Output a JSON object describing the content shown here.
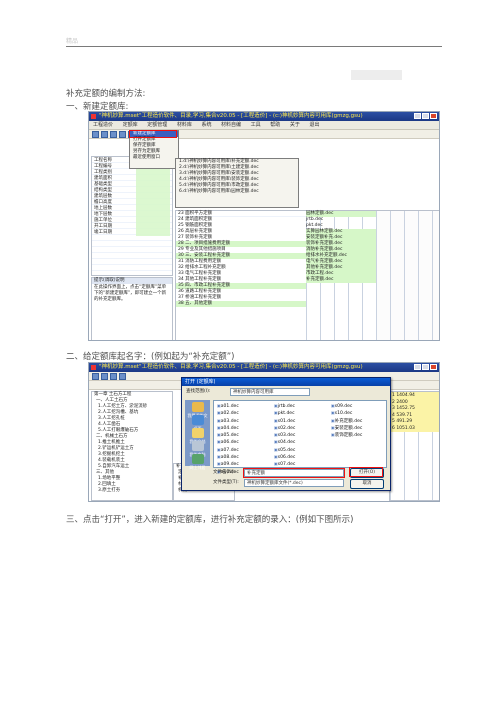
{
  "header": {
    "mark": "精品"
  },
  "intro": "补充定额的编制方法:",
  "step1": "一、新建定额库:",
  "step2": "二、给定额库起名字：(例如起为“补充定额”)",
  "step3": "三、点击“打开”，进入新建的定额库，进行补充定额的录入：(例如下图所示)",
  "shot1": {
    "title": "\"神机妙算.mset\"工程造价软件、目录,学习,集合v20.05 - [工程造价] - (c:)神机妙算内容可用库(gmzg,gsu)",
    "menus": [
      "工程造价",
      "定额库",
      "定额管理",
      "材料库",
      "系统",
      "材料自编",
      "工具",
      "帮助",
      "关于",
      "退出"
    ],
    "file_menu": [
      "新建定额库",
      "打开定额库",
      "保存定额库",
      "另存为定额库",
      "最近使用窗口"
    ],
    "recent": [
      "1.d:\\神机妙算内容可用库\\补充定额.dec",
      "2.d:\\神机妙算内容可用库\\土建定额.dec",
      "3.d:\\神机妙算内容可用库\\安装定额.dec",
      "4.d:\\神机妙算内容可用库\\装饰定额.dec",
      "5.d:\\神机妙算内容可用库\\市政定额.dec",
      "6.d:\\神机妙算内容可用库\\园林定额.dec"
    ],
    "left_rows": [
      "工程名称",
      "工程编号",
      "工程类别",
      "建筑面积",
      "基础类型",
      "结构类型",
      "建筑层数",
      "檐口高度",
      "地上层数",
      "地下层数",
      "施工单位",
      "开工日期",
      "竣工日期"
    ],
    "table_rows": [
      [
        "23",
        "0",
        "1",
        "面积平方定额"
      ],
      [
        "24",
        "0",
        "1",
        "建筑面积定额"
      ],
      [
        "25",
        "0",
        "1",
        "钢筋面积定额"
      ],
      [
        "26",
        "0",
        "1",
        "高层补充定额"
      ],
      [
        "27",
        "0",
        "1",
        "装饰补充定额"
      ],
      [
        "28",
        "0",
        "1",
        "二、项目措施费用定额"
      ],
      [
        "29",
        "0",
        "1",
        "专业及其他措施项目"
      ],
      [
        "30",
        "0",
        "1",
        "三、安装工程补充定额"
      ],
      [
        "31",
        "0",
        "1",
        "消防工程费用定额"
      ],
      [
        "32",
        "0",
        "1",
        "给排水工程补充定额"
      ],
      [
        "33",
        "0",
        "1",
        "电气工程补充定额"
      ],
      [
        "34",
        "0",
        "1",
        "其他工程补充定额"
      ],
      [
        "35",
        "0",
        "1",
        "四、市政工程补充定额"
      ],
      [
        "36",
        "0",
        "1",
        "道路工程补充定额"
      ],
      [
        "37",
        "0",
        "1",
        "桥涵工程补充定额"
      ],
      [
        "38",
        "0",
        "1",
        "五、其他定额"
      ]
    ],
    "right_rows": [
      "园林定额.dec",
      "",
      "jrtb.dec",
      "",
      "pkt.dec",
      "",
      "实算园林定额.dec",
      "安装定额补充.dec",
      "装饰补充定额.dec",
      "消防补充定额.dec",
      "给排水补充定额.dec",
      "电气补充定额.dec",
      "其他补充定额.dec",
      "",
      "市政工程.dec",
      "",
      "补充定额.dec"
    ],
    "note": "提示(调取)说明",
    "note_text": "在此操作界面上，点击“定额库”菜单下的“新建定额库”，即可建立一个新的补充定额库。"
  },
  "shot2": {
    "title": "\"神机妙算.mset\"工程造价软件、目录,学习,集合v20.05 - [工程造价] - (c:)神机妙算内容可用库(gmzg,gsu)",
    "dialog_title": "打开 (定额库)",
    "look_in_label": "查找范围(I):",
    "look_in_value": "神机妙算内容可用库",
    "places": [
      "我最近的文档",
      "桌面",
      "我的文档",
      "我的电脑",
      "网上邻居"
    ],
    "files_col1": [
      "a01.dec",
      "a02.dec",
      "a03.dec",
      "a04.dec",
      "a05.dec",
      "a06.dec",
      "a07.dec",
      "a08.dec",
      "a09.dec",
      "a10.dec",
      "a11.dec",
      "a12.dec",
      "a13.dec",
      "a14.dec",
      "a15.dec"
    ],
    "files_col2": [
      "jrtb.dec",
      "pkt.dec",
      "s01.dec",
      "s02.dec",
      "s03.dec",
      "s04.dec",
      "s05.dec",
      "s06.dec",
      "s07.dec",
      "s08.dec",
      "s09.dec",
      "s10.dec",
      "补充定额.dec",
      "安装定额.dec",
      "装饰定额.dec"
    ],
    "filename_label": "文件名(N):",
    "filename_value": "补充定额",
    "filetype_label": "文件类型(T):",
    "filetype_value": "神机妙算定额库文件(*.dec)",
    "open_button": "打开(O)",
    "cancel_button": "取消",
    "tree": [
      "第一章 土石方工程",
      "一、人工土石方",
      "1.人工挖土方、淤泥流砂",
      "2.人工挖沟槽、基坑",
      "3.人工挖孔桩",
      "4.人工凿石",
      "5.人工打眼爆破石方",
      "二、机械土石方",
      "1.推土机推土",
      "2.铲运机铲运土方",
      "3.挖掘机挖土",
      "4.装载机装土",
      "5.自卸汽车运土",
      "三、其他",
      "1.场地平整",
      "2.回填土",
      "3.原土打夯"
    ],
    "tree2": [
      "补充定额库(A)",
      "定额子目",
      "补充子目",
      "材料",
      "机械",
      "配合比"
    ],
    "numbers": [
      "1",
      "1404.94",
      "2",
      "2400",
      "3",
      "1452.75",
      "4",
      "539.71",
      "5",
      "491.29",
      "6",
      "1051.03"
    ]
  }
}
